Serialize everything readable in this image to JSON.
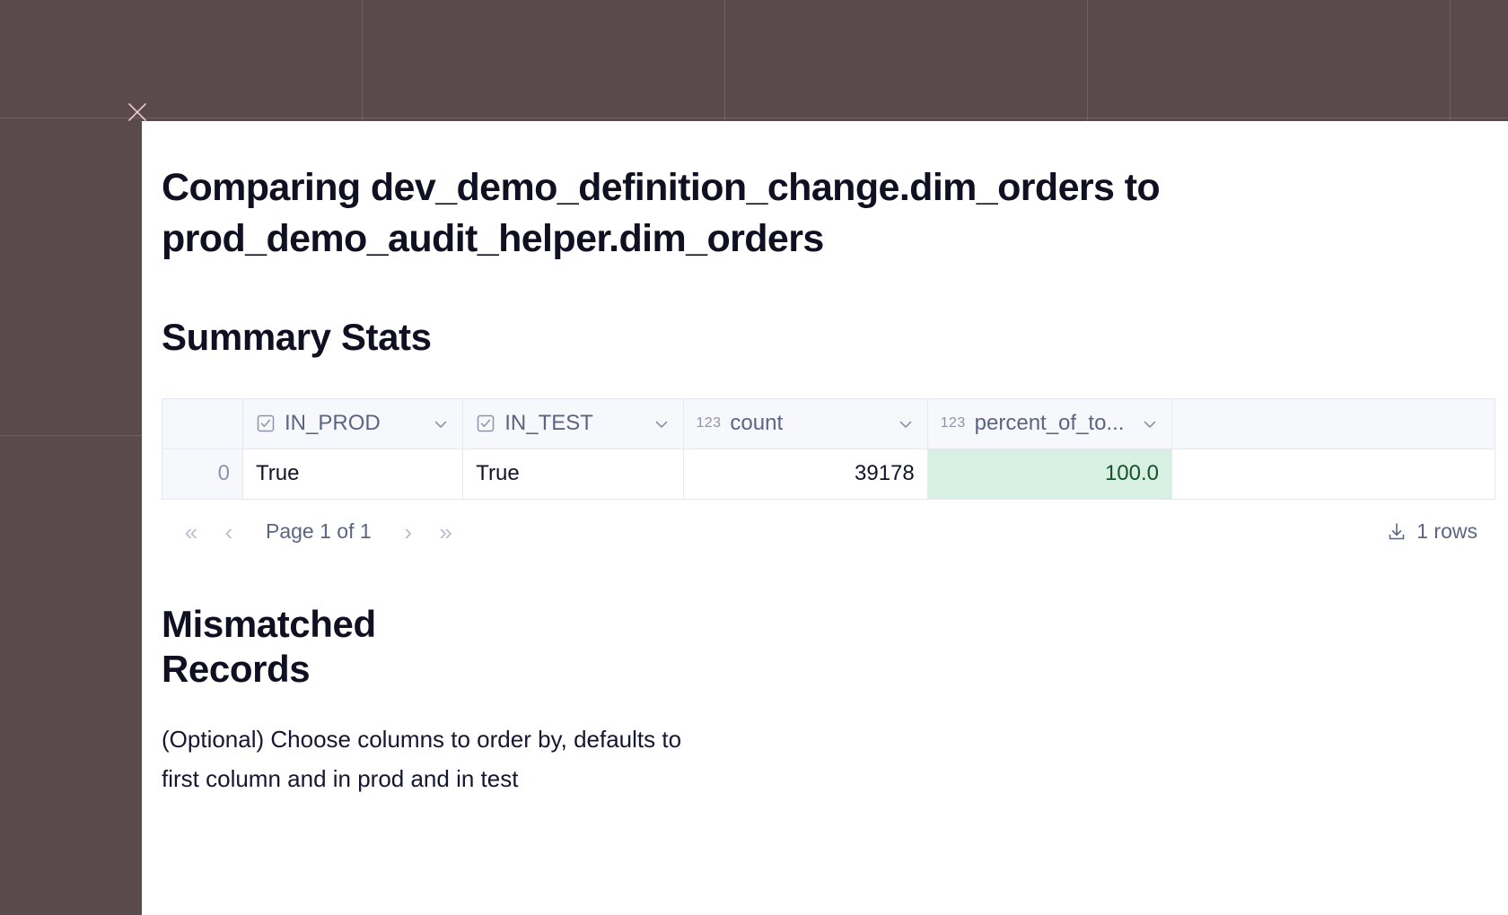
{
  "backdrop": {
    "color": "#5b4a4d",
    "grid_line_color": "#7a6569"
  },
  "close_button": {
    "icon": "close-icon",
    "color": "#eec9c9"
  },
  "panel": {
    "background": "#ffffff",
    "title": "Comparing dev_demo_definition_change.dim_orders to prod_demo_audit_helper.dim_orders",
    "sections": {
      "summary": {
        "heading": "Summary Stats"
      },
      "mismatched": {
        "heading": "Mismatched Records",
        "body": "(Optional) Choose columns to order by, defaults to first column and in prod and in test"
      }
    }
  },
  "table": {
    "columns": [
      {
        "label": "",
        "type": "index",
        "type_icon": ""
      },
      {
        "label": "IN_PROD",
        "type": "boolean",
        "type_icon": "checkbox-icon"
      },
      {
        "label": "IN_TEST",
        "type": "boolean",
        "type_icon": "checkbox-icon"
      },
      {
        "label": "count",
        "type": "number",
        "type_icon": "123"
      },
      {
        "label": "percent_of_to...",
        "type": "number",
        "type_icon": "123"
      },
      {
        "label": "",
        "type": "blank",
        "type_icon": ""
      }
    ],
    "rows": [
      {
        "index": "0",
        "in_prod": "True",
        "in_test": "True",
        "count": "39178",
        "percent_of_total": "100.0"
      }
    ],
    "highlight_color": "#d8f0e1"
  },
  "pagination": {
    "first_label": "«",
    "prev_label": "‹",
    "page_label": "Page 1 of 1",
    "next_label": "›",
    "last_label": "»",
    "rows_label": "1 rows",
    "download_icon": "download-icon"
  }
}
